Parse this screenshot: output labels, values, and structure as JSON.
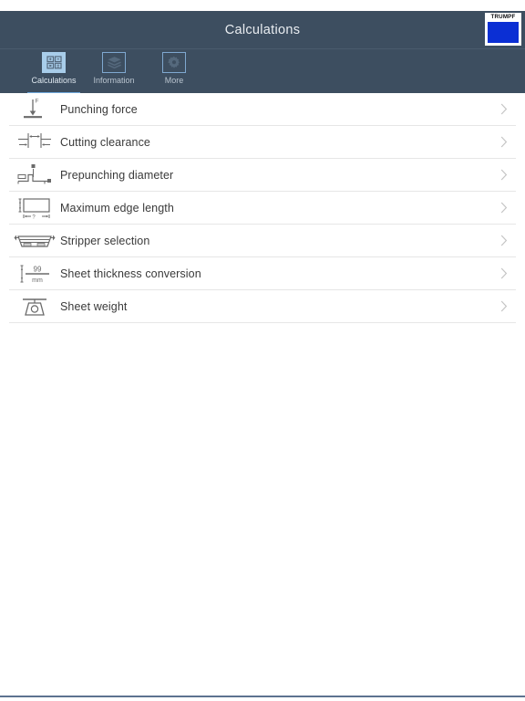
{
  "header": {
    "title": "Calculations",
    "brand": {
      "wordmark": "TRUMPF",
      "square_color": "#0b2fd4"
    }
  },
  "tabs": [
    {
      "label": "Calculations",
      "icon": "calculator-icon",
      "active": true
    },
    {
      "label": "Information",
      "icon": "layers-icon",
      "active": false
    },
    {
      "label": "More",
      "icon": "gear-icon",
      "active": false
    }
  ],
  "list": {
    "items": [
      {
        "label": "Punching force",
        "icon": "punching-force-icon"
      },
      {
        "label": "Cutting clearance",
        "icon": "cutting-clearance-icon"
      },
      {
        "label": "Prepunching diameter",
        "icon": "prepunching-diameter-icon"
      },
      {
        "label": "Maximum edge length",
        "icon": "maximum-edge-length-icon"
      },
      {
        "label": "Stripper selection",
        "icon": "stripper-selection-icon"
      },
      {
        "label": "Sheet thickness conversion",
        "icon": "sheet-thickness-icon"
      },
      {
        "label": "Sheet weight",
        "icon": "sheet-weight-icon"
      }
    ]
  },
  "icon_labels": {
    "force": "F",
    "question": "?",
    "thickness_value": "99",
    "thickness_unit": "mm"
  },
  "colors": {
    "header_bg": "#3d4e60",
    "tab_active": "#a8cdea",
    "accent_underline": "#6fa8dc",
    "row_text": "#3a3a3a",
    "divider": "#e6e6e6",
    "bottom_rule": "#5d7290"
  }
}
